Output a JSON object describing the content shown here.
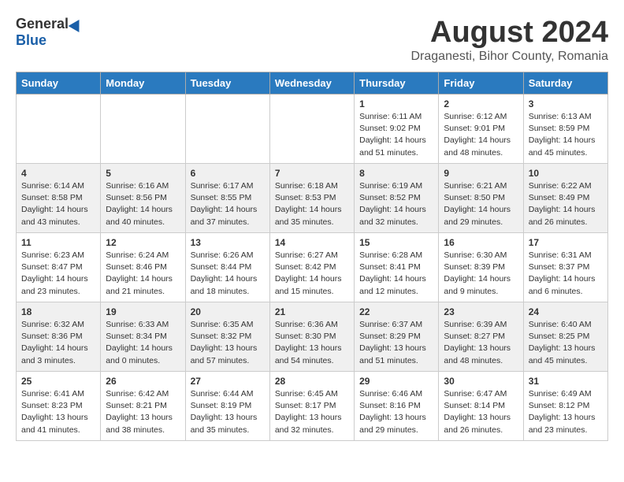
{
  "header": {
    "logo_general": "General",
    "logo_blue": "Blue",
    "month_year": "August 2024",
    "location": "Draganesti, Bihor County, Romania"
  },
  "days_of_week": [
    "Sunday",
    "Monday",
    "Tuesday",
    "Wednesday",
    "Thursday",
    "Friday",
    "Saturday"
  ],
  "weeks": [
    [
      {
        "day": "",
        "info": ""
      },
      {
        "day": "",
        "info": ""
      },
      {
        "day": "",
        "info": ""
      },
      {
        "day": "",
        "info": ""
      },
      {
        "day": "1",
        "info": "Sunrise: 6:11 AM\nSunset: 9:02 PM\nDaylight: 14 hours\nand 51 minutes."
      },
      {
        "day": "2",
        "info": "Sunrise: 6:12 AM\nSunset: 9:01 PM\nDaylight: 14 hours\nand 48 minutes."
      },
      {
        "day": "3",
        "info": "Sunrise: 6:13 AM\nSunset: 8:59 PM\nDaylight: 14 hours\nand 45 minutes."
      }
    ],
    [
      {
        "day": "4",
        "info": "Sunrise: 6:14 AM\nSunset: 8:58 PM\nDaylight: 14 hours\nand 43 minutes."
      },
      {
        "day": "5",
        "info": "Sunrise: 6:16 AM\nSunset: 8:56 PM\nDaylight: 14 hours\nand 40 minutes."
      },
      {
        "day": "6",
        "info": "Sunrise: 6:17 AM\nSunset: 8:55 PM\nDaylight: 14 hours\nand 37 minutes."
      },
      {
        "day": "7",
        "info": "Sunrise: 6:18 AM\nSunset: 8:53 PM\nDaylight: 14 hours\nand 35 minutes."
      },
      {
        "day": "8",
        "info": "Sunrise: 6:19 AM\nSunset: 8:52 PM\nDaylight: 14 hours\nand 32 minutes."
      },
      {
        "day": "9",
        "info": "Sunrise: 6:21 AM\nSunset: 8:50 PM\nDaylight: 14 hours\nand 29 minutes."
      },
      {
        "day": "10",
        "info": "Sunrise: 6:22 AM\nSunset: 8:49 PM\nDaylight: 14 hours\nand 26 minutes."
      }
    ],
    [
      {
        "day": "11",
        "info": "Sunrise: 6:23 AM\nSunset: 8:47 PM\nDaylight: 14 hours\nand 23 minutes."
      },
      {
        "day": "12",
        "info": "Sunrise: 6:24 AM\nSunset: 8:46 PM\nDaylight: 14 hours\nand 21 minutes."
      },
      {
        "day": "13",
        "info": "Sunrise: 6:26 AM\nSunset: 8:44 PM\nDaylight: 14 hours\nand 18 minutes."
      },
      {
        "day": "14",
        "info": "Sunrise: 6:27 AM\nSunset: 8:42 PM\nDaylight: 14 hours\nand 15 minutes."
      },
      {
        "day": "15",
        "info": "Sunrise: 6:28 AM\nSunset: 8:41 PM\nDaylight: 14 hours\nand 12 minutes."
      },
      {
        "day": "16",
        "info": "Sunrise: 6:30 AM\nSunset: 8:39 PM\nDaylight: 14 hours\nand 9 minutes."
      },
      {
        "day": "17",
        "info": "Sunrise: 6:31 AM\nSunset: 8:37 PM\nDaylight: 14 hours\nand 6 minutes."
      }
    ],
    [
      {
        "day": "18",
        "info": "Sunrise: 6:32 AM\nSunset: 8:36 PM\nDaylight: 14 hours\nand 3 minutes."
      },
      {
        "day": "19",
        "info": "Sunrise: 6:33 AM\nSunset: 8:34 PM\nDaylight: 14 hours\nand 0 minutes."
      },
      {
        "day": "20",
        "info": "Sunrise: 6:35 AM\nSunset: 8:32 PM\nDaylight: 13 hours\nand 57 minutes."
      },
      {
        "day": "21",
        "info": "Sunrise: 6:36 AM\nSunset: 8:30 PM\nDaylight: 13 hours\nand 54 minutes."
      },
      {
        "day": "22",
        "info": "Sunrise: 6:37 AM\nSunset: 8:29 PM\nDaylight: 13 hours\nand 51 minutes."
      },
      {
        "day": "23",
        "info": "Sunrise: 6:39 AM\nSunset: 8:27 PM\nDaylight: 13 hours\nand 48 minutes."
      },
      {
        "day": "24",
        "info": "Sunrise: 6:40 AM\nSunset: 8:25 PM\nDaylight: 13 hours\nand 45 minutes."
      }
    ],
    [
      {
        "day": "25",
        "info": "Sunrise: 6:41 AM\nSunset: 8:23 PM\nDaylight: 13 hours\nand 41 minutes."
      },
      {
        "day": "26",
        "info": "Sunrise: 6:42 AM\nSunset: 8:21 PM\nDaylight: 13 hours\nand 38 minutes."
      },
      {
        "day": "27",
        "info": "Sunrise: 6:44 AM\nSunset: 8:19 PM\nDaylight: 13 hours\nand 35 minutes."
      },
      {
        "day": "28",
        "info": "Sunrise: 6:45 AM\nSunset: 8:17 PM\nDaylight: 13 hours\nand 32 minutes."
      },
      {
        "day": "29",
        "info": "Sunrise: 6:46 AM\nSunset: 8:16 PM\nDaylight: 13 hours\nand 29 minutes."
      },
      {
        "day": "30",
        "info": "Sunrise: 6:47 AM\nSunset: 8:14 PM\nDaylight: 13 hours\nand 26 minutes."
      },
      {
        "day": "31",
        "info": "Sunrise: 6:49 AM\nSunset: 8:12 PM\nDaylight: 13 hours\nand 23 minutes."
      }
    ]
  ]
}
